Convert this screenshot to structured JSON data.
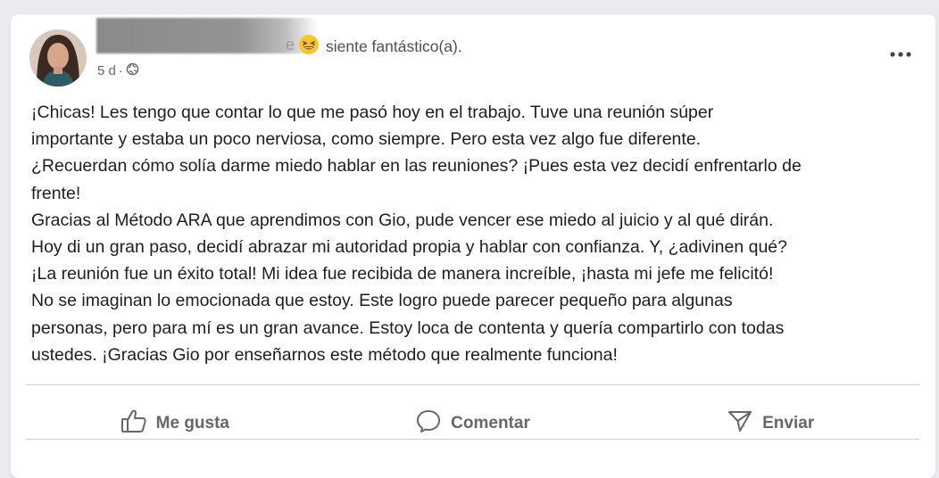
{
  "post": {
    "feeling_text": "siente fantástico(a).",
    "name_tail": "e",
    "emoji": "grinning-squinting-face",
    "time": "5 d",
    "dot": "·",
    "privacy_icon": "globe-icon",
    "more_icon": "more-options-icon",
    "body_lines": [
      "¡Chicas! Les tengo que contar lo que me pasó hoy en el trabajo. Tuve una reunión súper",
      "importante y estaba un poco nerviosa, como siempre. Pero esta vez algo fue diferente.",
      "¿Recuerdan cómo solía darme miedo hablar en las reuniones? ¡Pues esta vez decidí enfrentarlo de",
      "frente!",
      "Gracias al Método ARA que aprendimos con Gio, pude vencer ese miedo al juicio y al qué dirán.",
      "Hoy di un gran paso, decidí abrazar mi autoridad propia y hablar con confianza. Y, ¿adivinen qué?",
      "¡La reunión fue un éxito total! Mi idea fue recibida de manera increíble, ¡hasta mi jefe me felicitó!",
      "No se imaginan lo emocionada que estoy. Este logro puede parecer pequeño para algunas",
      "personas, pero para mí es un gran avance. Estoy loca de contenta y quería compartirlo con todas",
      "ustedes. ¡Gracias Gio por enseñarnos este método que realmente funciona!"
    ]
  },
  "actions": {
    "like": "Me gusta",
    "comment": "Comentar",
    "send": "Enviar"
  },
  "colors": {
    "background": "#e9ebee",
    "card": "#ffffff",
    "secondary_text": "#65676b",
    "divider": "#ced0d4"
  }
}
